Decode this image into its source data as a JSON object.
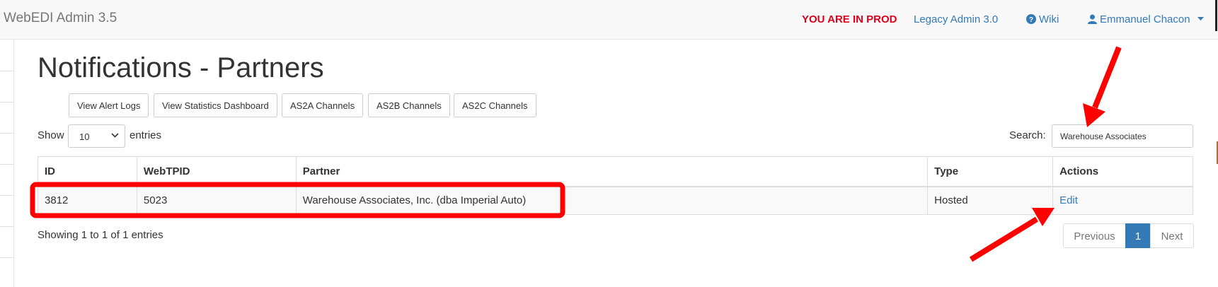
{
  "navbar": {
    "brand": "WebEDI Admin 3.5",
    "prod_warning": "YOU ARE IN PROD",
    "prod_color": "#e0001b",
    "legacy_link": "Legacy Admin 3.0",
    "wiki_link": "Wiki",
    "user_name": "Emmanuel Chacon"
  },
  "page": {
    "title": "Notifications - Partners"
  },
  "buttons": {
    "alert_logs": "View Alert Logs",
    "stats_dashboard": "View Statistics Dashboard",
    "as2a": "AS2A Channels",
    "as2b": "AS2B Channels",
    "as2c": "AS2C Channels"
  },
  "length_control": {
    "show": "Show",
    "value": "10",
    "entries": "entries"
  },
  "search": {
    "label": "Search:",
    "value": "Warehouse Associates"
  },
  "table": {
    "columns": [
      "ID",
      "WebTPID",
      "Partner",
      "Type",
      "Actions"
    ],
    "rows": [
      {
        "id": "3812",
        "webtpid": "5023",
        "partner": "Warehouse Associates, Inc. (dba Imperial Auto)",
        "type": "Hosted",
        "action": "Edit"
      }
    ]
  },
  "info": "Showing 1 to 1 of 1 entries",
  "pagination": {
    "previous": "Previous",
    "page": "1",
    "next": "Next"
  },
  "annotations": {
    "color": "#ff0000"
  }
}
